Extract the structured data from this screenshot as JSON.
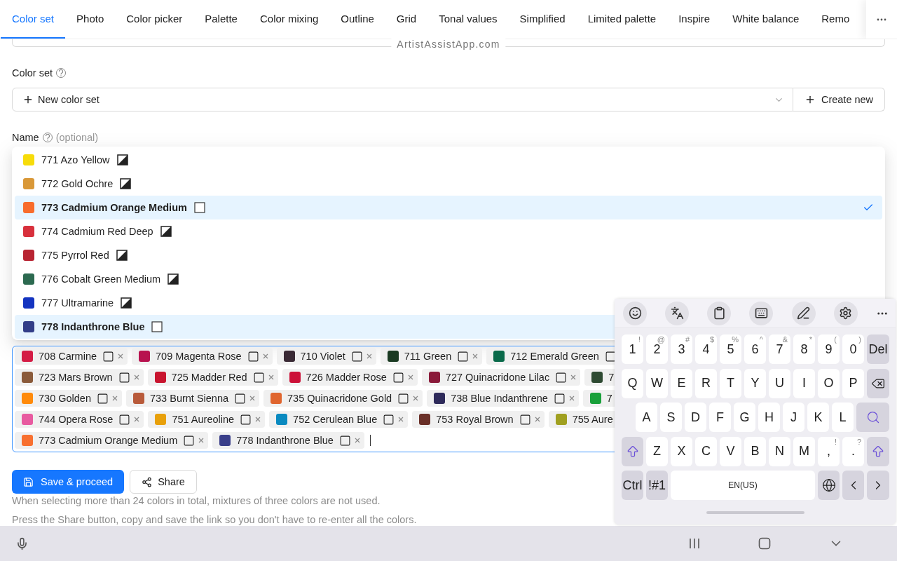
{
  "tabs": [
    {
      "label": "Color set",
      "selected": true
    },
    {
      "label": "Photo",
      "selected": false
    },
    {
      "label": "Color picker",
      "selected": false
    },
    {
      "label": "Palette",
      "selected": false
    },
    {
      "label": "Color mixing",
      "selected": false
    },
    {
      "label": "Outline",
      "selected": false
    },
    {
      "label": "Grid",
      "selected": false
    },
    {
      "label": "Tonal values",
      "selected": false
    },
    {
      "label": "Simplified",
      "selected": false
    },
    {
      "label": "Limited palette",
      "selected": false
    },
    {
      "label": "Inspire",
      "selected": false
    },
    {
      "label": "White balance",
      "selected": false
    },
    {
      "label": "Remo",
      "selected": false
    }
  ],
  "site_label": "ArtistAssistApp.com",
  "color_set": {
    "label": "Color set",
    "value": "New color set",
    "create_button": "Create new"
  },
  "name": {
    "label": "Name",
    "hint": "(optional)"
  },
  "dropdown": [
    {
      "label": "771 Azo Yellow",
      "color": "#f7dc0a",
      "kind": "split",
      "selected": false
    },
    {
      "label": "772 Gold Ochre",
      "color": "#d99838",
      "kind": "split",
      "selected": false
    },
    {
      "label": "773 Cadmium Orange Medium",
      "color": "#f86c2c",
      "kind": "blank",
      "selected": true,
      "checkmark": true
    },
    {
      "label": "774 Cadmium Red Deep",
      "color": "#d8303c",
      "kind": "split",
      "selected": false
    },
    {
      "label": "775 Pyrrol Red",
      "color": "#b82432",
      "kind": "split",
      "selected": false
    },
    {
      "label": "776 Cobalt Green Medium",
      "color": "#2c6a50",
      "kind": "split",
      "selected": false
    },
    {
      "label": "777 Ultramarine",
      "color": "#1434c0",
      "kind": "split",
      "selected": false
    },
    {
      "label": "778 Indanthrone Blue",
      "color": "#323e88",
      "kind": "blank",
      "selected": true
    }
  ],
  "tag_rows": [
    [
      {
        "label": "708 Carmine",
        "color": "#d41c45"
      },
      {
        "label": "709 Magenta Rose",
        "color": "#b8124f"
      },
      {
        "label": "710 Violet",
        "color": "#3a2a35"
      },
      {
        "label": "711 Green",
        "color": "#1a3a22"
      },
      {
        "label": "712 Emerald Green",
        "color": "#0a6a4a",
        "kind": "cut_square"
      }
    ],
    [
      {
        "label": "723 Mars Brown",
        "color": "#8a5a3a"
      },
      {
        "label": "725 Madder Red",
        "color": "#c8142e"
      },
      {
        "label": "726 Madder Rose",
        "color": "#cc1038"
      },
      {
        "label": "727 Quinacridone Lilac",
        "color": "#8a1a3a"
      },
      {
        "label": "7",
        "color": "#2e4a32",
        "kind": "cut_text"
      }
    ],
    [
      {
        "label": "730 Golden",
        "color": "#ff8a0a"
      },
      {
        "label": "733 Burnt Sienna",
        "color": "#b85a3a"
      },
      {
        "label": "735 Quinacridone Gold",
        "color": "#e0652e"
      },
      {
        "label": "738 Blue Indanthrene",
        "color": "#2e2a5a"
      },
      {
        "label": "7",
        "color": "#18a03a",
        "kind": "cut_text"
      }
    ],
    [
      {
        "label": "744 Opera Rose",
        "color": "#e85aa0"
      },
      {
        "label": "751 Aureoline",
        "color": "#e8a00a"
      },
      {
        "label": "752 Cerulean Blue",
        "color": "#0a8ac0"
      },
      {
        "label": "753 Royal Brown",
        "color": "#6a3028"
      },
      {
        "label": "755 Aure",
        "color": "#a0a020",
        "kind": "cut_text"
      }
    ],
    [
      {
        "label": "773 Cadmium Orange Medium",
        "color": "#f87030"
      },
      {
        "label": "778 Indanthrone Blue",
        "color": "#3a3f8a"
      }
    ]
  ],
  "buttons": {
    "save": "Save & proceed",
    "share": "Share"
  },
  "help": [
    "When selecting more than 24 colors in total, mixtures of three colors are not used.",
    "Press the Share button, copy and save the link so you don't have to re-enter all the colors."
  ],
  "keyboard": {
    "rows": [
      [
        {
          "kind": "char",
          "label": "1",
          "hint": "!"
        },
        {
          "kind": "char",
          "label": "2",
          "hint": "@"
        },
        {
          "kind": "char",
          "label": "3",
          "hint": "#"
        },
        {
          "kind": "char",
          "label": "4",
          "hint": "$"
        },
        {
          "kind": "char",
          "label": "5",
          "hint": "%"
        },
        {
          "kind": "char",
          "label": "6",
          "hint": "^"
        },
        {
          "kind": "char",
          "label": "7",
          "hint": "&"
        },
        {
          "kind": "char",
          "label": "8",
          "hint": "*"
        },
        {
          "kind": "char",
          "label": "9",
          "hint": "("
        },
        {
          "kind": "char",
          "label": "0",
          "hint": ")"
        },
        {
          "kind": "action",
          "label": "Del"
        }
      ],
      [
        {
          "kind": "char",
          "label": "Q"
        },
        {
          "kind": "char",
          "label": "W"
        },
        {
          "kind": "char",
          "label": "E"
        },
        {
          "kind": "char",
          "label": "R"
        },
        {
          "kind": "char",
          "label": "T"
        },
        {
          "kind": "char",
          "label": "Y"
        },
        {
          "kind": "char",
          "label": "U"
        },
        {
          "kind": "char",
          "label": "I"
        },
        {
          "kind": "char",
          "label": "O"
        },
        {
          "kind": "char",
          "label": "P"
        },
        {
          "kind": "backspace"
        }
      ],
      [
        {
          "kind": "char",
          "label": "A"
        },
        {
          "kind": "char",
          "label": "S"
        },
        {
          "kind": "char",
          "label": "D"
        },
        {
          "kind": "char",
          "label": "F"
        },
        {
          "kind": "char",
          "label": "G"
        },
        {
          "kind": "char",
          "label": "H"
        },
        {
          "kind": "char",
          "label": "J"
        },
        {
          "kind": "char",
          "label": "K"
        },
        {
          "kind": "char",
          "label": "L"
        },
        {
          "kind": "search"
        }
      ],
      [
        {
          "kind": "shift"
        },
        {
          "kind": "char",
          "label": "Z"
        },
        {
          "kind": "char",
          "label": "X"
        },
        {
          "kind": "char",
          "label": "C"
        },
        {
          "kind": "char",
          "label": "V"
        },
        {
          "kind": "char",
          "label": "B"
        },
        {
          "kind": "char",
          "label": "N"
        },
        {
          "kind": "char",
          "label": "M"
        },
        {
          "kind": "char",
          "label": ",",
          "hint": "!"
        },
        {
          "kind": "char",
          "label": ".",
          "hint": "?"
        },
        {
          "kind": "shift"
        }
      ]
    ],
    "bottom_row": {
      "ctrl": "Ctrl",
      "symbols": "!#1",
      "space": "EN(US)"
    }
  }
}
